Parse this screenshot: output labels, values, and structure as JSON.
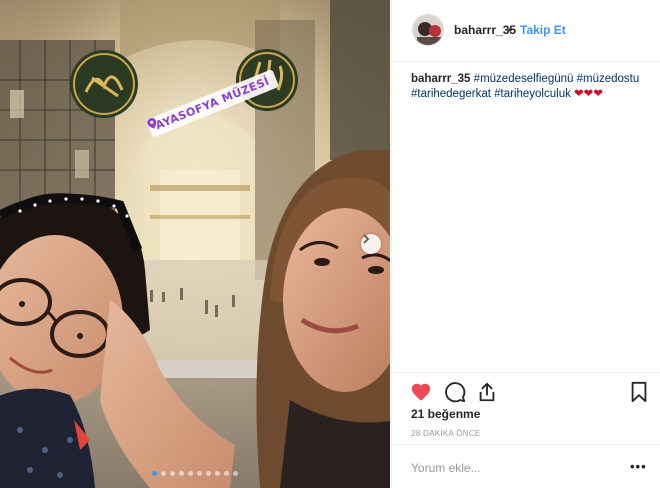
{
  "photo": {
    "location_sticker": "AYASOFYA MÜZESİ",
    "carousel": {
      "total": 10,
      "active_index": 0
    }
  },
  "header": {
    "username": "baharrr_35",
    "separator": "•",
    "follow_label": "Takip Et"
  },
  "caption": {
    "username": "baharrr_35",
    "tags": [
      "#müzedeselfiegünü",
      "#müzedostu",
      "#tarihedegerkat",
      "#tariheyolculuk"
    ],
    "hearts": "❤❤❤"
  },
  "stats": {
    "likes": "21 beğenme",
    "time": "28 DAKİKA ÖNCE"
  },
  "comment": {
    "placeholder": "Yorum ekle...",
    "more": "•••"
  },
  "colors": {
    "accent": "#3897f0",
    "like_red": "#ed4956",
    "hashtag": "#003569",
    "muted": "#999999",
    "sticker_text": "#8b3fd1"
  },
  "icons": [
    "map-pin-icon",
    "chevron-right-icon",
    "heart-icon",
    "comment-icon",
    "share-icon",
    "bookmark-icon"
  ]
}
